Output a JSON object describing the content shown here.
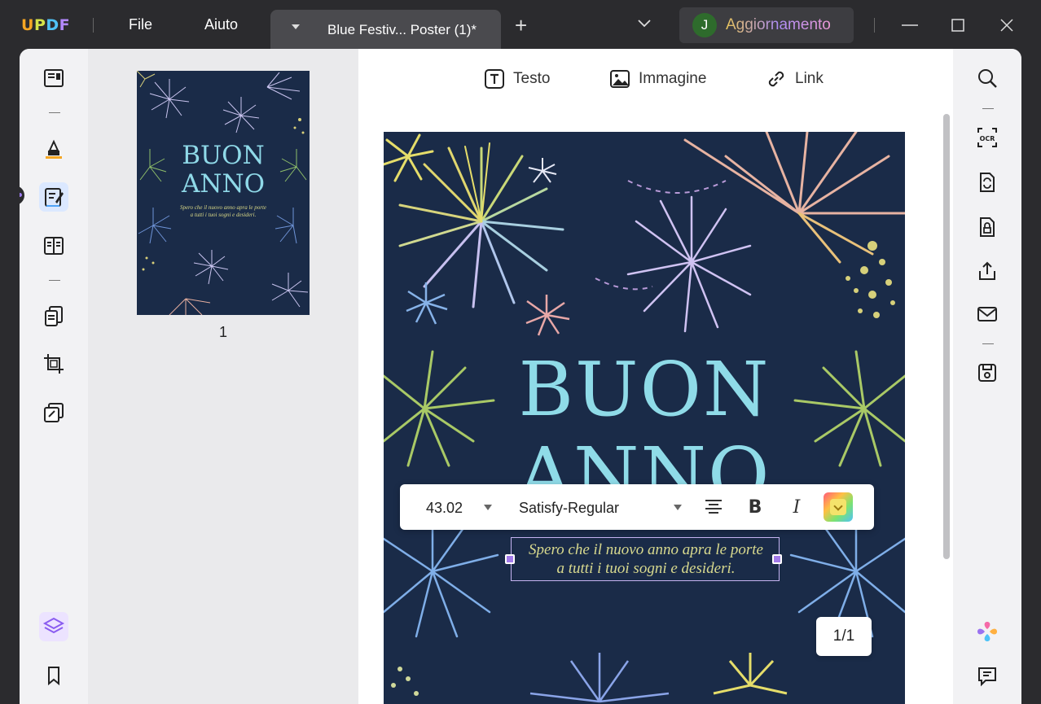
{
  "app": {
    "logo": "UPDF",
    "menu": [
      "File",
      "Aiuto"
    ],
    "tab_title": "Blue Festiv... Poster (1)*",
    "upgrade_avatar": "J",
    "upgrade_label": "Aggiornamento"
  },
  "left_toolbar": [
    "reader-icon",
    "comment-icon",
    "edit-pdf-icon",
    "organize-icon",
    "convert-icon",
    "crop-icon",
    "protect-icon",
    "layers-icon",
    "bookmark-icon"
  ],
  "right_toolbar": [
    "search-icon",
    "ocr-icon",
    "convert-icon",
    "protect-icon",
    "share-icon",
    "email-icon",
    "save-icon",
    "ai-icon",
    "comment-list-icon"
  ],
  "ocr_label": "OCR",
  "thumbnail": {
    "title_line1": "BUON",
    "title_line2": "ANNO",
    "subtitle_line1": "Spero che il nuovo anno apra le porte",
    "subtitle_line2": "a tutti i tuoi sogni e desideri.",
    "page_number": "1"
  },
  "edit_toolbar": {
    "text": "Testo",
    "image": "Immagine",
    "link": "Link"
  },
  "document": {
    "title_line1": "BUON",
    "title_line2": "ANNO",
    "body_line1": "Spero che il nuovo anno apra le porte",
    "body_line2": "a tutti i tuoi sogni e desideri."
  },
  "format_toolbar": {
    "font_size": "43.02",
    "font_name": "Satisfy-Regular",
    "bold": "B",
    "italic": "I",
    "text_color": "#f4e36b"
  },
  "page_indicator": "1/1",
  "colors": {
    "poster_bg": "#1a2b48",
    "title_color": "#8fdbe8",
    "accent": "#a37bea"
  }
}
